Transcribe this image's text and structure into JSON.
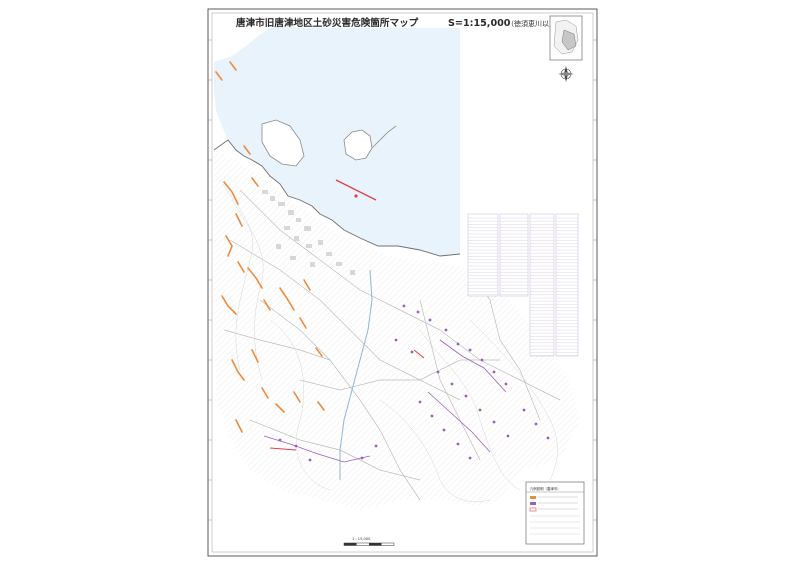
{
  "map": {
    "title": "唐津市旧唐津地区土砂災害危険箇所マップ",
    "scale": "S=1:15,000",
    "area_note": "（徳須恵川以東）",
    "legend_header": "凡例説明（唐津市）",
    "scale_bar_label": "1 : 15,000"
  },
  "colors": {
    "sea": "#e8f3fb",
    "land": "#ffffff",
    "road": "#bdbdbd",
    "contour": "#d6d6d6",
    "hazard_orange": "#f08a3c",
    "hazard_purple": "#9a5fc2",
    "hazard_red": "#e2404d",
    "table_line": "#c4b8dc",
    "frame": "#333333"
  },
  "icons": [
    "compass-icon",
    "locator-map-icon"
  ]
}
